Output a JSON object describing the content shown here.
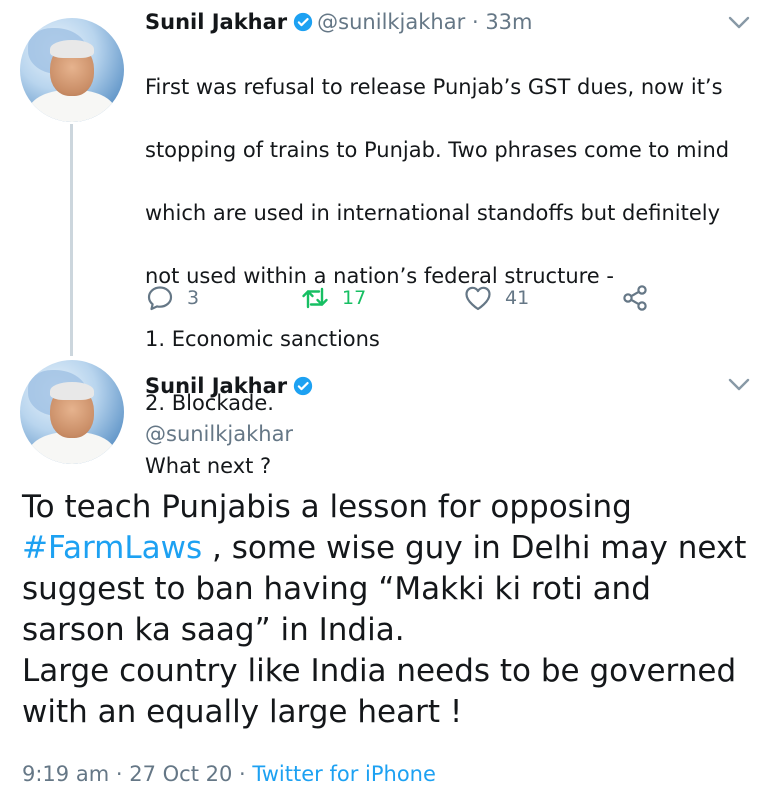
{
  "colors": {
    "link": "#1da1f2",
    "muted": "#657786",
    "retweet": "#17bf63",
    "verified": "#1da1f2"
  },
  "tweet1": {
    "name": "Sunil Jakhar",
    "handle": "@sunilkjakhar",
    "separator": "·",
    "age": "33m",
    "text_lines": [
      "First was refusal to release Punjab’s GST dues, now it’s",
      "stopping of trains to Punjab. Two phrases come to mind",
      "which are used in international standoffs but definitely",
      "not used within a nation’s federal structure -",
      "1. Economic sanctions",
      "2. Blockade.",
      "What next  ?"
    ],
    "replies": "3",
    "retweets": "17",
    "likes": "41",
    "icons": {
      "reply": "reply-icon",
      "retweet": "retweet-icon",
      "like": "heart-icon",
      "share": "share-icon",
      "menu": "chevron-down-icon",
      "verified": "verified-badge-icon"
    }
  },
  "tweet2": {
    "name": "Sunil Jakhar",
    "handle": "@sunilkjakhar",
    "text_before": "To teach Punjabis a lesson for opposing ",
    "hashtag": "#FarmLaws",
    "text_after": " , some wise guy in Delhi may next suggest to ban  having “Makki ki roti and sarson ka saag” in India.",
    "text_line2": "Large country like India needs to be governed with an equally large heart !",
    "time": "9:19 am",
    "date": "27 Oct 20",
    "separator": "·",
    "source": "Twitter for iPhone"
  }
}
